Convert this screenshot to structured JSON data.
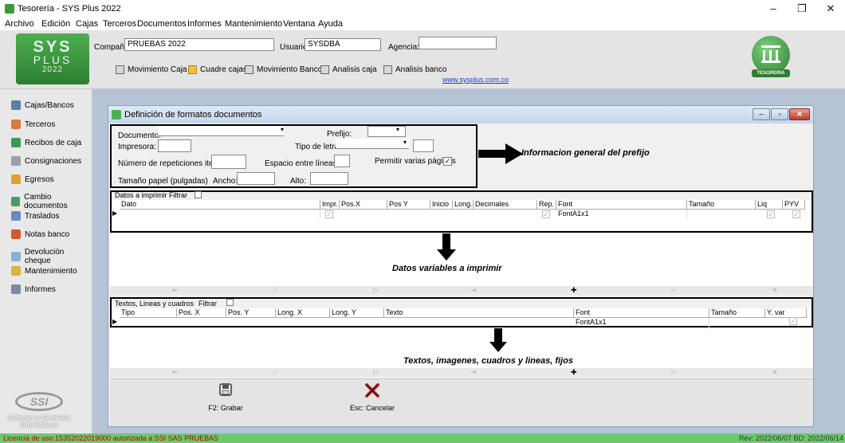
{
  "window": {
    "title": "Tesorería - SYS Plus 2022",
    "controls": {
      "minimize": "–",
      "restore": "❐",
      "close": "✕"
    }
  },
  "menu": [
    {
      "label": "Archivo"
    },
    {
      "label": "Edición"
    },
    {
      "label": "Cajas"
    },
    {
      "label": "Terceros"
    },
    {
      "label": "Documentos"
    },
    {
      "label": "Informes"
    },
    {
      "label": "Mantenimiento"
    },
    {
      "label": "Ventana"
    },
    {
      "label": "Ayuda"
    }
  ],
  "header": {
    "logo": {
      "line1": "SYS",
      "line2": "PLUS",
      "line3": "2022"
    },
    "company_label": "Compañía:",
    "company_value": "PRUEBAS 2022",
    "user_label": "Usuario:",
    "user_value": "SYSDBA",
    "agency_label": "Agencia:",
    "agency_value": "",
    "toolbar": [
      {
        "label": "Movimiento Caja",
        "icon": "cash-register-icon"
      },
      {
        "label": "Cuadre cajas",
        "icon": "folder-icon"
      },
      {
        "label": "Movimiento Banco",
        "icon": "bank-icon"
      },
      {
        "label": "Analisis caja",
        "icon": "bank-icon"
      },
      {
        "label": "Analisis banco",
        "icon": "bank-icon"
      }
    ],
    "website": "www.sysplus.com.co",
    "tesoreria_label": "TESORERIA"
  },
  "sidebar": [
    {
      "label": "Cajas/Bancos",
      "icon": "cash-icon",
      "color": "#5a7fa8"
    },
    {
      "label": "Terceros",
      "icon": "person-icon",
      "color": "#d97a3a"
    },
    {
      "label": "Recibos de caja",
      "icon": "receipt-icon",
      "color": "#3a9a5a"
    },
    {
      "label": "Consignaciones",
      "icon": "bank-icon",
      "color": "#9aa0a8"
    },
    {
      "label": "Egresos",
      "icon": "expense-icon",
      "color": "#e0a030"
    },
    {
      "label": "Cambio documentos",
      "icon": "swap-icon",
      "color": "#4a9a6a"
    },
    {
      "label": "Traslados",
      "icon": "transfer-icon",
      "color": "#6a8ac8"
    },
    {
      "label": "Notas banco",
      "icon": "note-icon",
      "color": "#d05a30"
    },
    {
      "label": "Devolución cheque",
      "icon": "cheque-icon",
      "color": "#8ab0d8"
    },
    {
      "label": "Mantenimiento",
      "icon": "gear-icon",
      "color": "#e0b040"
    },
    {
      "label": "Informes",
      "icon": "printer-icon",
      "color": "#7a8aa8"
    }
  ],
  "ssi": {
    "logo": "SSI",
    "line1": "Software y Servicios",
    "line2": "Informáticos"
  },
  "dialog": {
    "title": "Definición de formatos documentos",
    "general": {
      "documento_label": "Documento:",
      "documento_value": "",
      "prefijo_label": "Prefijo:",
      "prefijo_value": "",
      "impresora_label": "Impresora:",
      "impresora_value": "",
      "tipo_letra_label": "Tipo de letra:",
      "tipo_letra_value": "",
      "tipo_letra_size": "",
      "repeticiones_label": "Número de repeticiones items:",
      "repeticiones_value": "",
      "espacio_label": "Espacio entre líneas:",
      "espacio_value": "",
      "varias_paginas_label": "Permitir varias páginas",
      "varias_paginas_checked": true,
      "papel_label": "Tamaño papel (pulgadas)",
      "ancho_label": "Ancho:",
      "ancho_value": "",
      "alto_label": "Alto:",
      "alto_value": ""
    },
    "annot_general": "Informacion general del prefijo",
    "datos": {
      "section_label": "Datos a imprimir",
      "filter_label": "Filtrar",
      "columns": [
        "Dato",
        "Impr.",
        "Pos.X",
        "Pos Y",
        "Inicio",
        "Long.",
        "Decimales",
        "Rep.",
        "Font",
        "Tamaño",
        "Liq",
        "PYV"
      ],
      "row": {
        "dato": "",
        "font": "FontA1x1",
        "impr": true,
        "rep": true,
        "liq": true,
        "pyv": true
      }
    },
    "annot_datos": "Datos variables a imprimir",
    "textos": {
      "section_label": "Textos, Lineas y cuadros",
      "filter_label": "Filtrar",
      "columns": [
        "Tipo",
        "Pos. X",
        "Pos. Y",
        "Long. X",
        "Long. Y",
        "Texto",
        "Font",
        "Tamaño",
        "Y. var"
      ],
      "row": {
        "font": "FontA1x1",
        "yvar": true
      }
    },
    "annot_textos": "Textos, imagenes, cuadros y lineas, fijos",
    "nav_glyphs": [
      "⇤",
      "⟋",
      "▷",
      "⇥",
      "✚",
      "⌐",
      "✕"
    ],
    "save_label": "F2: Grabar",
    "cancel_label": "Esc: Cancelar"
  },
  "status": {
    "license": "Licencia de uso:15352022019000 autorizada a:SSI SAS PRUEBAS",
    "revision": "Rev: 2022/06/07 BD: 2022/06/14"
  }
}
